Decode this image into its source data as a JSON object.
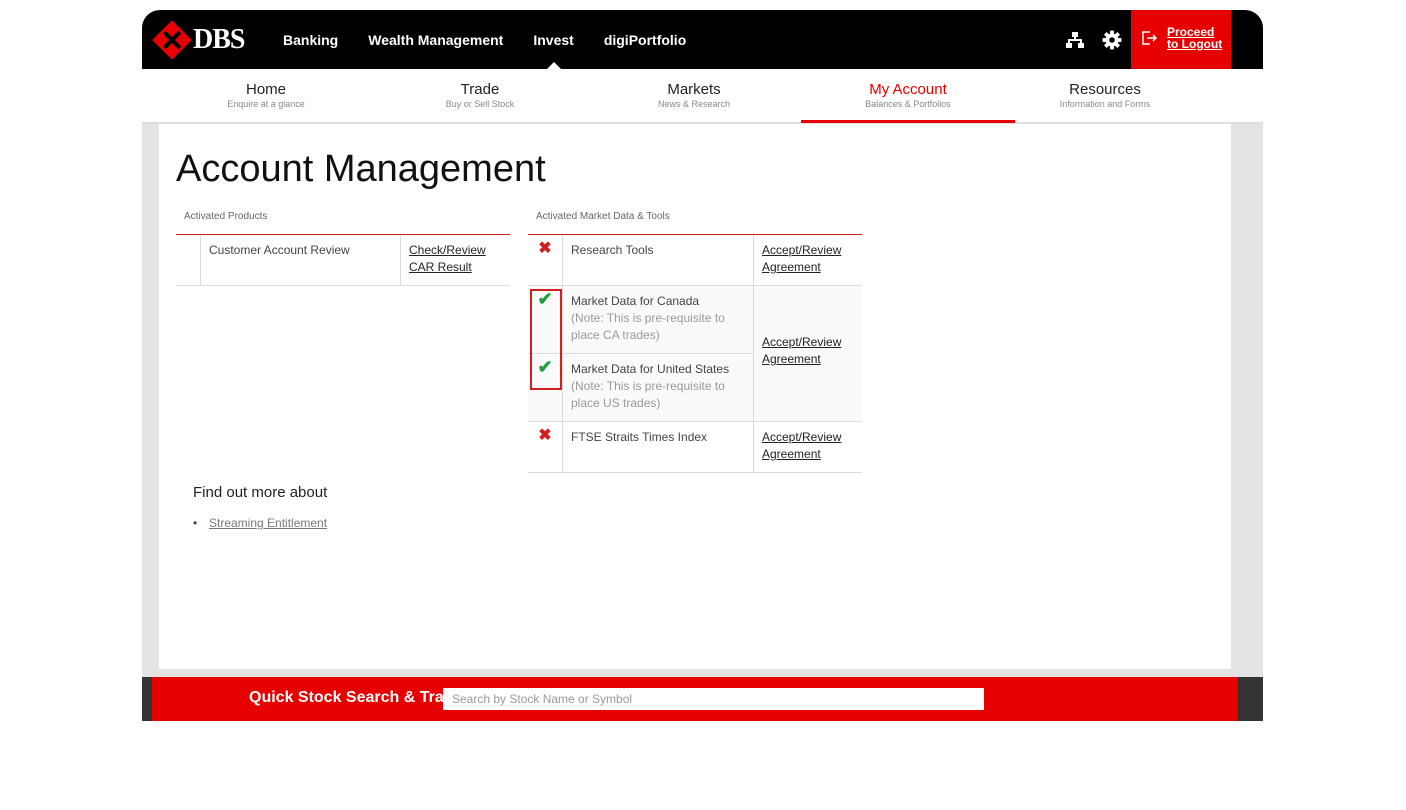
{
  "header": {
    "logo_text": "DBS",
    "nav": [
      "Banking",
      "Wealth Management",
      "Invest",
      "digiPortfolio"
    ],
    "logout_label": "Proceed to Logout",
    "icons": [
      "sitemap-icon",
      "gear-icon",
      "logout-icon"
    ],
    "brand_color": "#e60000"
  },
  "subnav": [
    {
      "title": "Home",
      "sub": "Enquire at a glance"
    },
    {
      "title": "Trade",
      "sub": "Buy or Sell Stock"
    },
    {
      "title": "Markets",
      "sub": "News & Research"
    },
    {
      "title": "My Account",
      "sub": "Balances & Portfolios"
    },
    {
      "title": "Resources",
      "sub": "Information and Forms"
    }
  ],
  "page_title": "Account Management",
  "activated_products": {
    "label": "Activated Products",
    "rows": [
      {
        "name": "Customer Account Review",
        "action": "Check/Review CAR Result"
      }
    ]
  },
  "market_data": {
    "label": "Activated Market Data & Tools",
    "rows": [
      {
        "status": "✖",
        "name": "Research Tools",
        "note": "",
        "action": "Accept/Review Agreement"
      },
      {
        "status": "✔",
        "name": "Market Data for Canada",
        "note": "(Note: This is pre-requisite to place CA trades)",
        "action": "Accept/Review Agreement"
      },
      {
        "status": "✔",
        "name": "Market Data for United States",
        "note": "(Note: This is pre-requisite to place US trades)",
        "action": ""
      },
      {
        "status": "✖",
        "name": "FTSE Straits Times Index",
        "note": "",
        "action": "Accept/Review Agreement"
      }
    ]
  },
  "find_out": {
    "title": "Find out more about",
    "links": [
      "Streaming Entitlement"
    ]
  },
  "quick_search": {
    "title": "Quick Stock Search & Trade",
    "placeholder": "Search by Stock Name or Symbol"
  }
}
